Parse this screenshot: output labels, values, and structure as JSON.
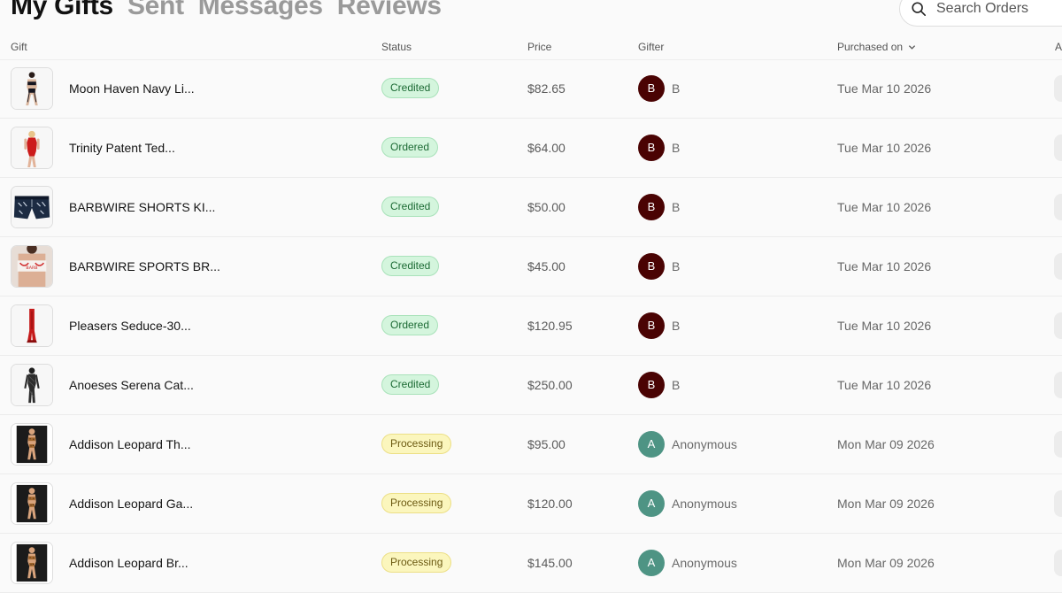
{
  "tabs": [
    {
      "label": "My Gifts",
      "active": true
    },
    {
      "label": "Sent",
      "active": false
    },
    {
      "label": "Messages",
      "active": false
    },
    {
      "label": "Reviews",
      "active": false
    }
  ],
  "search": {
    "placeholder": "Search Orders",
    "icon": "search-icon"
  },
  "table": {
    "columns": {
      "gift": "Gift",
      "status": "Status",
      "price": "Price",
      "gifter": "Gifter",
      "purchased_on": "Purchased on",
      "actions": "A"
    },
    "rows": [
      {
        "name": "Moon Haven Navy Li...",
        "status": "Credited",
        "price": "$82.65",
        "gifter_initial": "B",
        "gifter": "B",
        "date": "Tue Mar 10 2026",
        "thumb_icon": "lingerie-set-icon"
      },
      {
        "name": "Trinity Patent Ted...",
        "status": "Ordered",
        "price": "$64.00",
        "gifter_initial": "B",
        "gifter": "B",
        "date": "Tue Mar 10 2026",
        "thumb_icon": "red-teddy-icon"
      },
      {
        "name": "BARBWIRE SHORTS KI...",
        "status": "Credited",
        "price": "$50.00",
        "gifter_initial": "B",
        "gifter": "B",
        "date": "Tue Mar 10 2026",
        "thumb_icon": "shorts-icon"
      },
      {
        "name": "BARBWIRE SPORTS BR...",
        "status": "Credited",
        "price": "$45.00",
        "gifter_initial": "B",
        "gifter": "B",
        "date": "Tue Mar 10 2026",
        "thumb_icon": "sports-bra-icon"
      },
      {
        "name": "Pleasers Seduce-30...",
        "status": "Ordered",
        "price": "$120.95",
        "gifter_initial": "B",
        "gifter": "B",
        "date": "Tue Mar 10 2026",
        "thumb_icon": "red-boot-icon"
      },
      {
        "name": "Anoeses Serena Cat...",
        "status": "Credited",
        "price": "$250.00",
        "gifter_initial": "B",
        "gifter": "B",
        "date": "Tue Mar 10 2026",
        "thumb_icon": "catsuit-icon"
      },
      {
        "name": "Addison Leopard Th...",
        "status": "Processing",
        "price": "$95.00",
        "gifter_initial": "A",
        "gifter": "Anonymous",
        "date": "Mon Mar 09 2026",
        "thumb_icon": "leopard-lingerie-icon"
      },
      {
        "name": "Addison Leopard Ga...",
        "status": "Processing",
        "price": "$120.00",
        "gifter_initial": "A",
        "gifter": "Anonymous",
        "date": "Mon Mar 09 2026",
        "thumb_icon": "leopard-lingerie-icon"
      },
      {
        "name": "Addison Leopard Br...",
        "status": "Processing",
        "price": "$145.00",
        "gifter_initial": "A",
        "gifter": "Anonymous",
        "date": "Mon Mar 09 2026",
        "thumb_icon": "leopard-lingerie-icon"
      }
    ]
  },
  "colors": {
    "active_tab": "#111111",
    "inactive_tab": "#9a9a9a",
    "badge_green_bg": "#d4f5dd",
    "badge_green_text": "#1c6a34",
    "badge_yellow_bg": "#fbf6bd",
    "badge_yellow_text": "#6c5a12",
    "avatar_b": "#4a0303",
    "avatar_a": "#4e9484"
  }
}
